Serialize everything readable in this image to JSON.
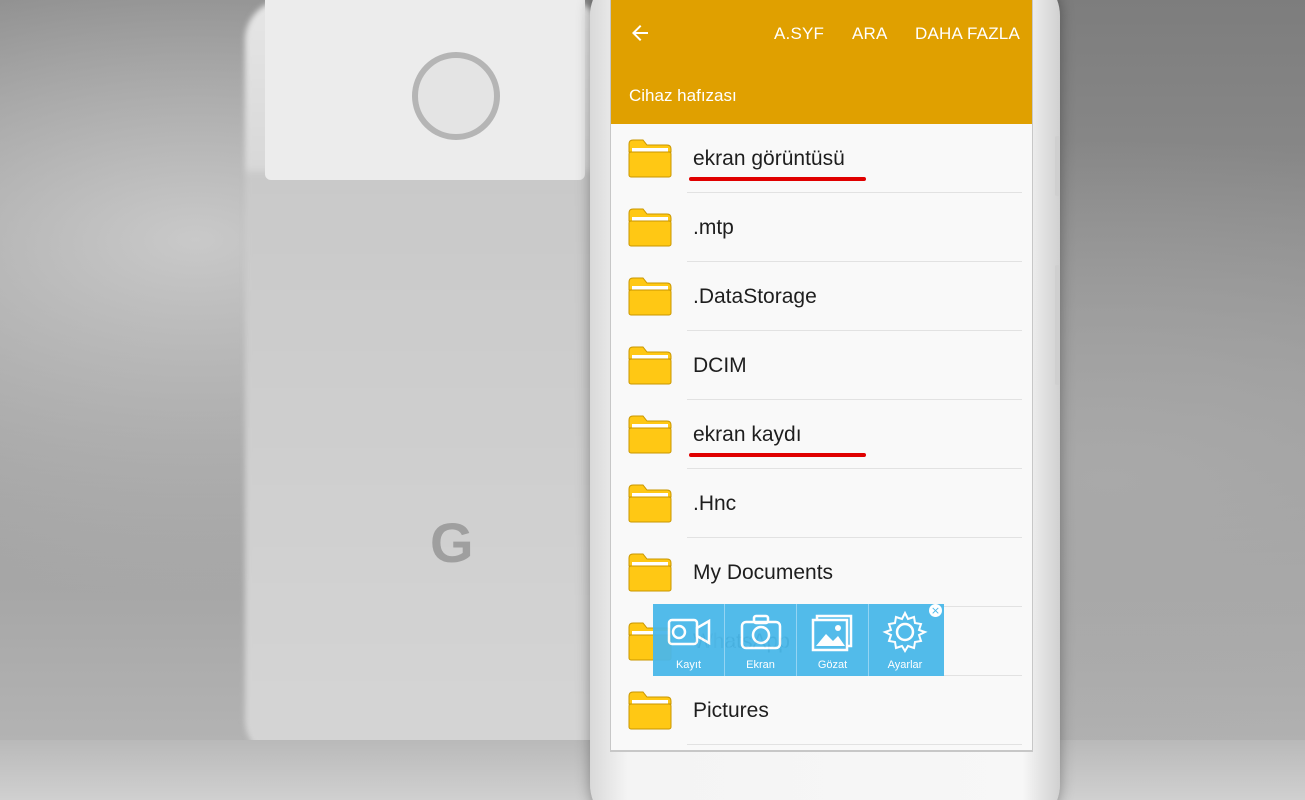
{
  "appbar": {
    "actions": [
      "A.SYF",
      "ARA",
      "DAHA FAZLA"
    ],
    "location": "Cihaz hafızası",
    "color": "#e0a000"
  },
  "folders": [
    {
      "name": "ekran görüntüsü",
      "highlighted": true
    },
    {
      "name": ".mtp",
      "highlighted": false
    },
    {
      "name": ".DataStorage",
      "highlighted": false
    },
    {
      "name": "DCIM",
      "highlighted": false
    },
    {
      "name": "ekran kaydı",
      "highlighted": true
    },
    {
      "name": ".Hnc",
      "highlighted": false
    },
    {
      "name": "My Documents",
      "highlighted": false
    },
    {
      "name": "WhatsApp",
      "highlighted": false
    },
    {
      "name": "Pictures",
      "highlighted": false
    }
  ],
  "widget": {
    "buttons": [
      "Kayıt",
      "Ekran",
      "Gözat",
      "Ayarlar"
    ],
    "close": "×",
    "color": "#4ab8ea"
  },
  "highlight_color": "#e00000",
  "folder_color": "#ffc814",
  "background": {
    "logo": "G"
  }
}
